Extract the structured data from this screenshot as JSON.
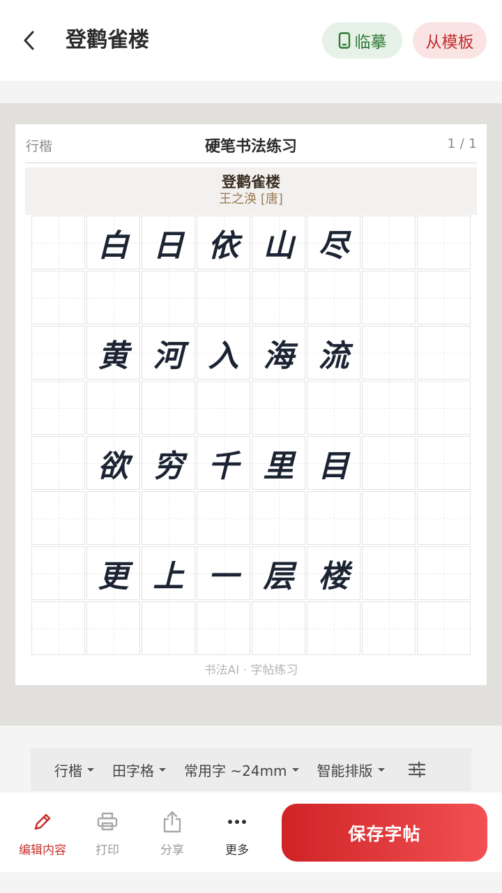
{
  "header": {
    "title": "登鹳雀楼",
    "trace_label": "临摹",
    "template_label": "从模板"
  },
  "sheet": {
    "style": "行楷",
    "heading": "硬笔书法练习",
    "page": "1 / 1",
    "poem_title": "登鹳雀楼",
    "poem_author": "王之涣 [唐]",
    "watermark": "书法AI · 字帖练习",
    "rows": [
      [
        "",
        "白",
        "日",
        "依",
        "山",
        "尽",
        "",
        ""
      ],
      [
        "",
        "",
        "",
        "",
        "",
        "",
        "",
        ""
      ],
      [
        "",
        "黄",
        "河",
        "入",
        "海",
        "流",
        "",
        ""
      ],
      [
        "",
        "",
        "",
        "",
        "",
        "",
        "",
        ""
      ],
      [
        "",
        "欲",
        "穷",
        "千",
        "里",
        "目",
        "",
        ""
      ],
      [
        "",
        "",
        "",
        "",
        "",
        "",
        "",
        ""
      ],
      [
        "",
        "更",
        "上",
        "一",
        "层",
        "楼",
        "",
        ""
      ],
      [
        "",
        "",
        "",
        "",
        "",
        "",
        "",
        ""
      ]
    ]
  },
  "filters": {
    "font": "行楷",
    "grid": "田字格",
    "size": "常用字 ~24mm",
    "layout": "智能排版"
  },
  "toolbar": {
    "edit_label": "编辑内容",
    "print_label": "打印",
    "share_label": "分享",
    "more_label": "更多",
    "save_label": "保存字帖"
  },
  "colors": {
    "accent": "#c9302c",
    "trace_green": "#2f7a36",
    "ink": "#1c2433"
  },
  "icons": {
    "back": "chevron-left-icon",
    "trace": "phone-icon",
    "edit": "pencil-icon",
    "print": "printer-icon",
    "share": "share-icon",
    "more": "more-dots-icon",
    "adjust": "sliders-icon"
  }
}
